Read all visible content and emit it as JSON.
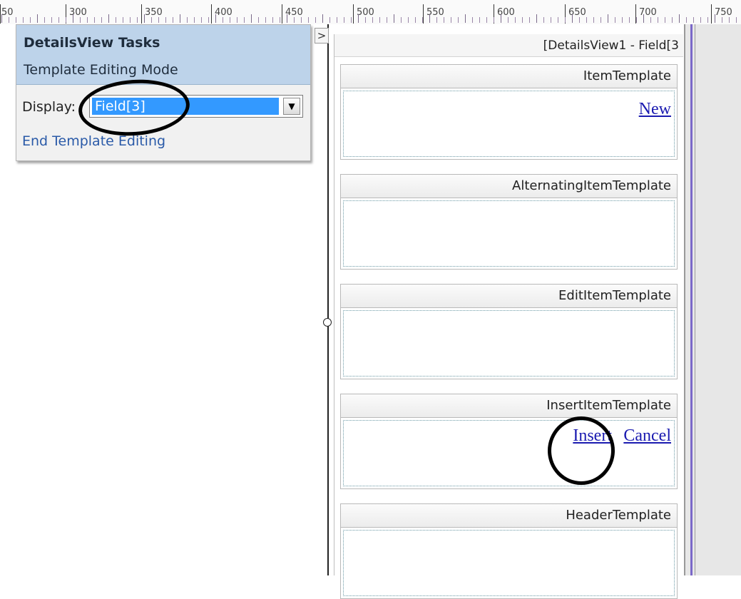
{
  "ruler": {
    "labels": [
      "50",
      "300",
      "350",
      "400",
      "450",
      "500",
      "550",
      "600",
      "650",
      "700",
      "750"
    ]
  },
  "tasks_panel": {
    "title": "DetailsView Tasks",
    "mode": "Template Editing Mode",
    "display_label": "Display:",
    "display_value": "Field[3]",
    "end_link": "End Template Editing",
    "expand_glyph": ">"
  },
  "details_view": {
    "title": "[DetailsView1 - Field[3",
    "templates": [
      {
        "header": "ItemTemplate",
        "links": [
          "New"
        ]
      },
      {
        "header": "AlternatingItemTemplate",
        "links": []
      },
      {
        "header": "EditItemTemplate",
        "links": []
      },
      {
        "header": "InsertItemTemplate",
        "links": [
          "Insert",
          "Cancel"
        ]
      },
      {
        "header": "HeaderTemplate",
        "links": []
      }
    ]
  },
  "colors": {
    "panel_header": "#bdd3ea",
    "selection": "#3399ff",
    "link": "#1a1ab0",
    "gutter_accent": "#7b68c9"
  }
}
